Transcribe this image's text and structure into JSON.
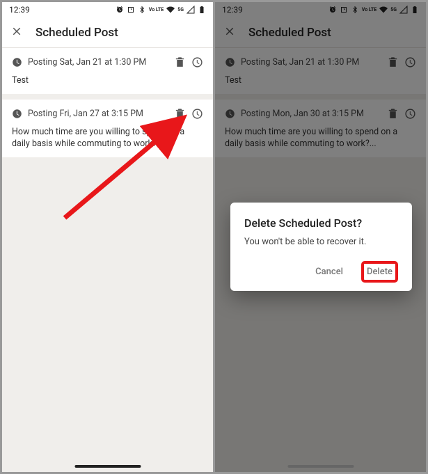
{
  "status": {
    "time": "12:39",
    "lte_label": "Vo LTE",
    "net_label": "5G"
  },
  "header": {
    "title": "Scheduled Post"
  },
  "left": {
    "posts": [
      {
        "when": "Posting Sat, Jan 21 at 1:30 PM",
        "body": "Test"
      },
      {
        "when": "Posting Fri, Jan 27 at 3:15 PM",
        "body": "How much time are you willing to spend on a daily basis while commuting to work?..."
      }
    ]
  },
  "right": {
    "posts": [
      {
        "when": "Posting Sat, Jan 21 at 1:30 PM",
        "body": "Test"
      },
      {
        "when": "Posting Mon, Jan 30 at 3:15 PM",
        "body": "How much time are you willing to spend on a daily basis while commuting to work?..."
      }
    ],
    "dialog": {
      "title": "Delete Scheduled Post?",
      "message": "You won't be able to recover it.",
      "cancel": "Cancel",
      "delete": "Delete"
    }
  },
  "annotation": {
    "arrow_color": "#e8171a"
  }
}
